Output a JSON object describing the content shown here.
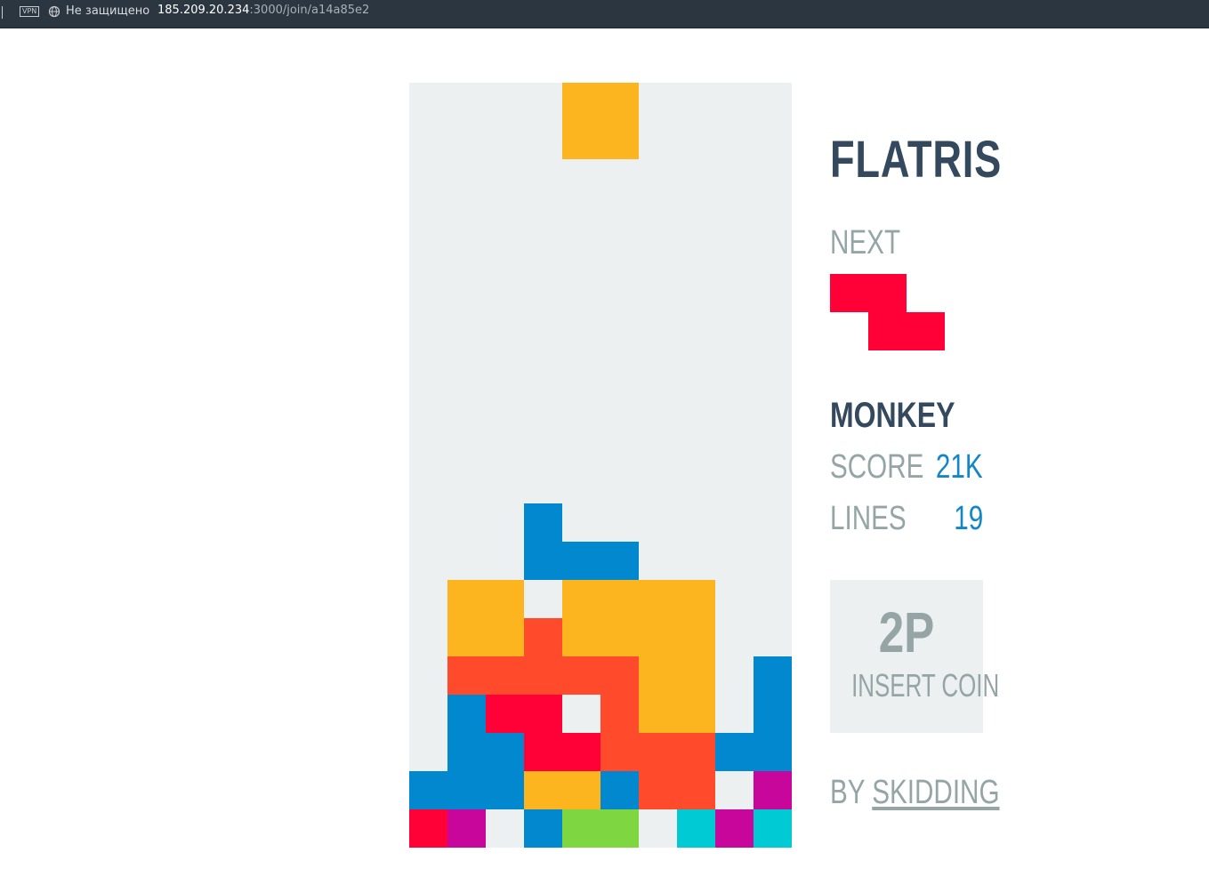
{
  "browser": {
    "vpn_label": "VPN",
    "security_text": "Не защищено",
    "url_host": "185.209.20.234",
    "url_path": ":3000/join/a14a85e2"
  },
  "colors": {
    "board_bg": "#ecf0f1",
    "O": "#fdb51f",
    "J": "#0288cf",
    "T": "#ff4b2b",
    "Z": "#ff0037",
    "S": "#7ed740",
    "I": "#00cad4",
    "L": "#c8069c"
  },
  "game": {
    "title": "FLATRIS",
    "next_label": "NEXT",
    "next_piece": "Z",
    "player_name": "MONKEY",
    "score_label": "SCORE",
    "score_value": "21K",
    "lines_label": "LINES",
    "lines_value": "19",
    "insert_big": "2P",
    "insert_text": "INSERT COIN",
    "credit_prefix": "BY ",
    "credit_link": "SKIDDING"
  },
  "board": {
    "cols": 10,
    "rows": 20,
    "falling_piece": "O",
    "grid": [
      "....OO....",
      "....OO....",
      "..........",
      "..........",
      "..........",
      "..........",
      "..........",
      "..........",
      "..........",
      "..........",
      "..........",
      "...J......",
      "...JJJ....",
      ".OO.OOOO..",
      ".OOTOOOO..",
      ".TTTTTOO.J",
      ".JZZ.TOO.J",
      ".JJZZTTTJJ",
      "JJJOOJTT.L",
      "ZL.JSS.ILI"
    ]
  }
}
